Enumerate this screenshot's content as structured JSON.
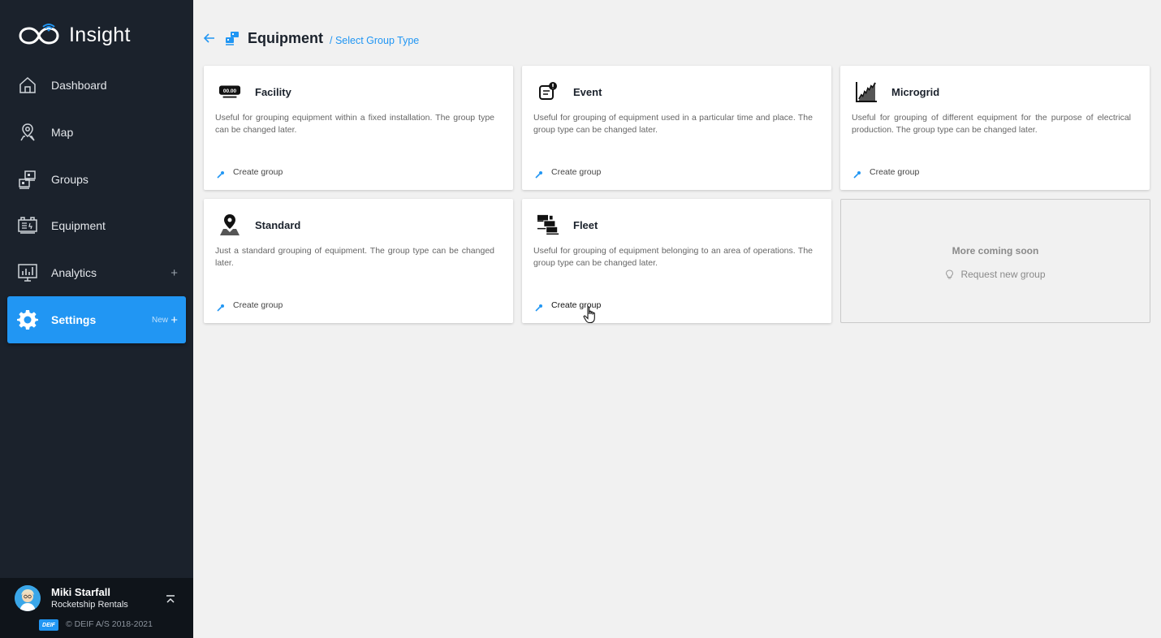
{
  "app": {
    "name": "Insight"
  },
  "sidebar": {
    "items": [
      {
        "label": "Dashboard",
        "icon": "home-icon"
      },
      {
        "label": "Map",
        "icon": "map-pin-icon"
      },
      {
        "label": "Groups",
        "icon": "groups-icon"
      },
      {
        "label": "Equipment",
        "icon": "equipment-icon"
      },
      {
        "label": "Analytics",
        "icon": "analytics-icon",
        "expand": "+"
      },
      {
        "label": "Settings",
        "icon": "gear-icon",
        "badge": "New",
        "expand": "+",
        "active": true
      }
    ],
    "user": {
      "name": "Miki Starfall",
      "organization": "Rocketship Rentals"
    },
    "footer": {
      "brand": "DEIF",
      "copyright": "© DEIF A/S 2018-2021"
    }
  },
  "header": {
    "title": "Equipment",
    "breadcrumb": "/ Select Group Type"
  },
  "cards": [
    {
      "title": "Facility",
      "icon": "clock-display-icon",
      "description": "Useful for grouping equipment within a fixed installation. The group type can be changed later.",
      "action": "Create group",
      "icon_text": "00.00"
    },
    {
      "title": "Event",
      "icon": "event-notice-icon",
      "description": "Useful for grouping of equipment used in a particular time and place. The group type can be changed later.",
      "action": "Create group"
    },
    {
      "title": "Microgrid",
      "icon": "chart-growth-icon",
      "description": "Useful for grouping of different equipment for the purpose of electrical production. The group type can be changed later.",
      "action": "Create group"
    },
    {
      "title": "Standard",
      "icon": "location-pin-icon",
      "description": "Just a standard grouping of equipment. The group type can be changed later.",
      "action": "Create group"
    },
    {
      "title": "Fleet",
      "icon": "fleet-stack-icon",
      "description": "Useful for grouping of equipment belonging to an area of operations. The group type can be changed later.",
      "action": "Create group"
    }
  ],
  "coming_soon": {
    "title": "More coming soon",
    "action": "Request new group"
  },
  "colors": {
    "sidebar": "#1b222c",
    "accent": "#2196f3",
    "background": "#f1f1f1"
  }
}
